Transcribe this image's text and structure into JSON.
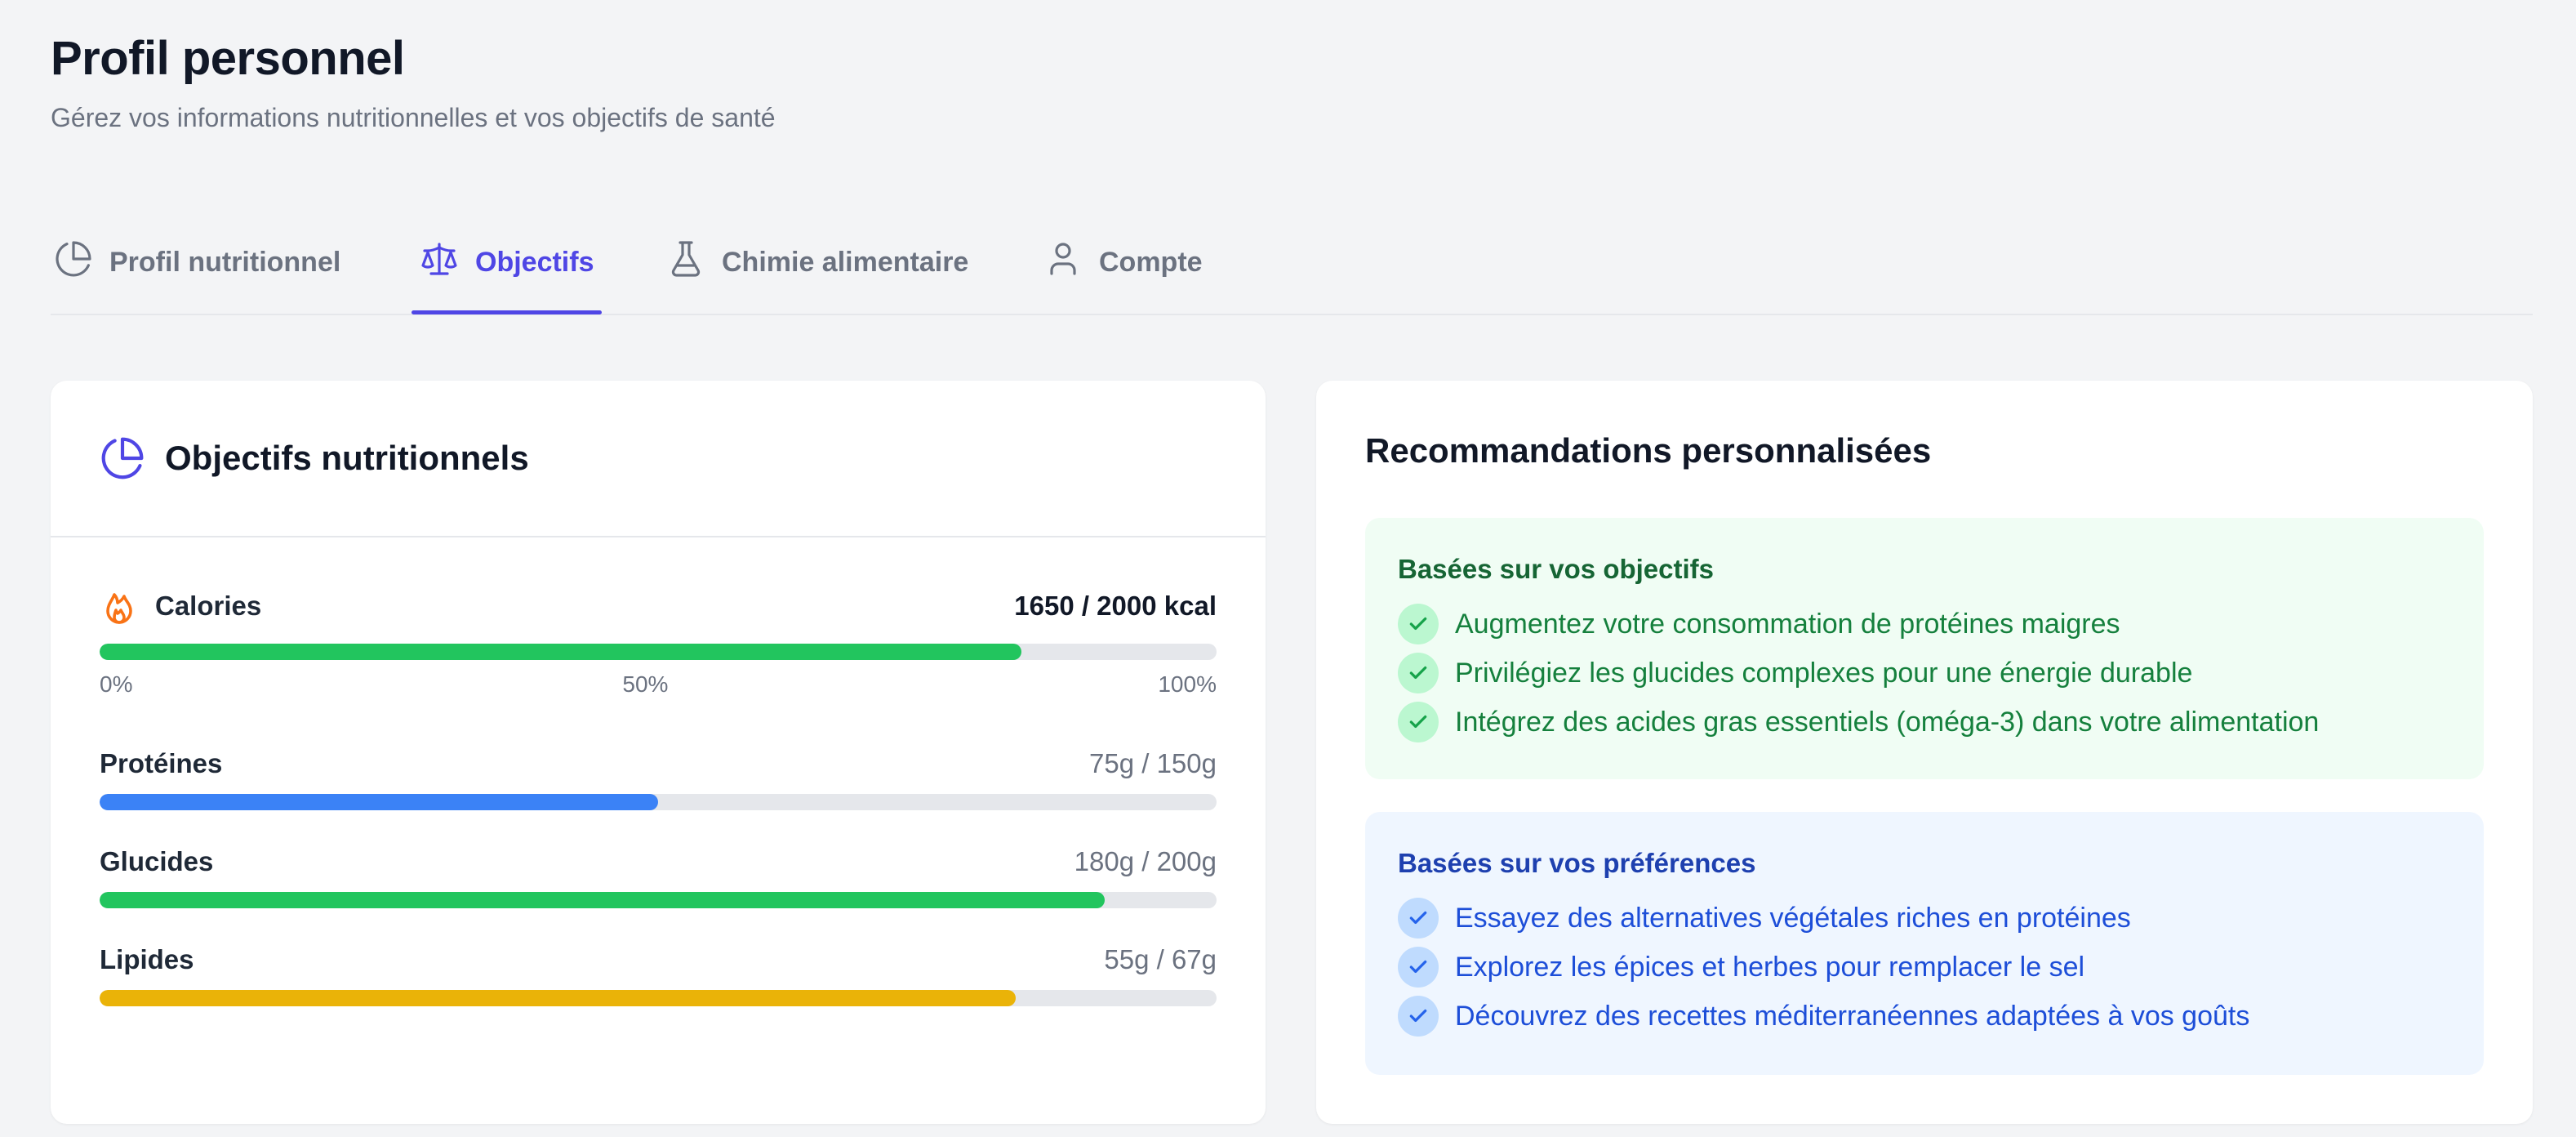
{
  "header": {
    "title": "Profil personnel",
    "subtitle": "Gérez vos informations nutritionnelles et vos objectifs de santé"
  },
  "tabs": [
    {
      "label": "Profil nutritionnel",
      "icon": "pie-chart-icon",
      "active": false
    },
    {
      "label": "Objectifs",
      "icon": "scale-icon",
      "active": true
    },
    {
      "label": "Chimie alimentaire",
      "icon": "flask-icon",
      "active": false
    },
    {
      "label": "Compte",
      "icon": "user-icon",
      "active": false
    }
  ],
  "goals": {
    "title": "Objectifs nutritionnels",
    "icon": "pie-chart-icon",
    "calories": {
      "label": "Calories",
      "icon": "flame-icon",
      "value": "1650 / 2000 kcal",
      "progress": 0.825,
      "color": "#22c55e",
      "scale": [
        "0%",
        "50%",
        "100%"
      ]
    },
    "macros": [
      {
        "label": "Protéines",
        "value": "75g / 150g",
        "progress": 0.5,
        "color": "#3b82f6"
      },
      {
        "label": "Glucides",
        "value": "180g / 200g",
        "progress": 0.9,
        "color": "#22c55e"
      },
      {
        "label": "Lipides",
        "value": "55g / 67g",
        "progress": 0.82,
        "color": "#eab308"
      }
    ]
  },
  "recommendations": {
    "title": "Recommandations personnalisées",
    "objectives": {
      "heading": "Basées sur vos objectifs",
      "items": [
        "Augmentez votre consommation de protéines maigres",
        "Privilégiez les glucides complexes pour une énergie durable",
        "Intégrez des acides gras essentiels (oméga-3) dans votre alimentation"
      ]
    },
    "preferences": {
      "heading": "Basées sur vos préférences",
      "items": [
        "Essayez des alternatives végétales riches en protéines",
        "Explorez les épices et herbes pour remplacer le sel",
        "Découvrez des recettes méditerranéennes adaptées à vos goûts"
      ]
    }
  },
  "colors": {
    "accent": "#4f46e5",
    "green": "#22c55e",
    "blue": "#3b82f6",
    "yellow": "#eab308",
    "flame": "#f97316"
  }
}
